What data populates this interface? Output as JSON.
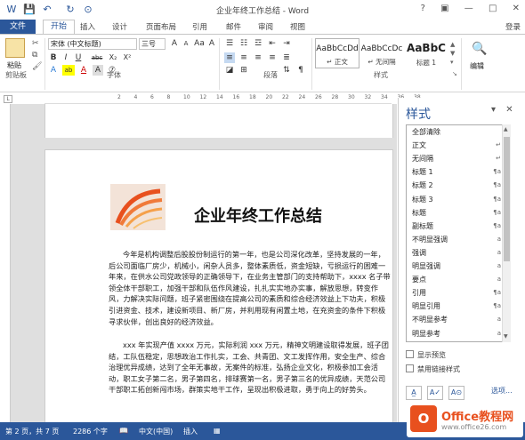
{
  "window": {
    "title": "企业年终工作总结 - Word",
    "help": "?",
    "signin": "登录"
  },
  "quick_access": {
    "save": "💾",
    "undo": "↶",
    "redo": "↻",
    "touch": "⊙"
  },
  "tabs": [
    "文件",
    "开始",
    "插入",
    "设计",
    "页面布局",
    "引用",
    "邮件",
    "审阅",
    "视图"
  ],
  "ribbon": {
    "clipboard": {
      "paste": "粘贴",
      "group": "剪贴板"
    },
    "font": {
      "name": "宋体 (中文标题)",
      "size": "三号",
      "group": "字体",
      "buttons_row1": [
        "A",
        "A",
        "Aa",
        "A",
        "wén"
      ],
      "buttons_row2": [
        "B",
        "I",
        "U",
        "abc",
        "X₂",
        "X²"
      ],
      "buttons_row3": [
        "A",
        "ab",
        "A",
        "A",
        "⑦"
      ]
    },
    "paragraph": {
      "group": "段落"
    },
    "styles": {
      "group": "样式",
      "items": [
        {
          "preview": "AaBbCcDd",
          "label": "↵ 正文"
        },
        {
          "preview": "AaBbCcDc",
          "label": "↵ 无间隔"
        },
        {
          "preview": "AaBbC",
          "label": "标题 1"
        }
      ]
    },
    "editing": {
      "label": "编辑"
    }
  },
  "ruler_ticks": [
    "2",
    "4",
    "6",
    "8",
    "10",
    "12",
    "14",
    "16",
    "18",
    "20",
    "22",
    "24",
    "26",
    "28",
    "30",
    "32",
    "34",
    "36",
    "38"
  ],
  "document": {
    "title": "企业年终工作总结",
    "paragraphs": [
      "今年是机构调整后股股份制运行的第一年，也是公司深化改革，坚持发展的一年，后公司面临厂房少，机械小，闲杂人员多，整体素质低，资金短缺，亏损运行的困难一年来，在供水公司党政领导的正确领导下，在业务主管部门的支持帮助下，xxxx 名子带领全体干部职工，加强干部和队伍作风建设，扎扎实实地办实事，解放思想，转变作风，力解决实际问题，班子紧密围绕在提高公司的素质和综合经济效益上下功夫，积极引进资金、技术，建设新项目、新厂房，并利用现有闲置土地，在充资金的条件下积极寻求伙伴，创出良好的经济效益。",
      "xxx 年实现产值 xxxx 万元，实际利润 xxx 万元，精神文明建设取得发展，班子团结，工队伍稳定，思想政治工作扎实，工会、共青团、文工发挥作用，安全生产、综合治理优异成绩，达到了全年无事故，无案件的标准，弘扬企业文化，积极参加工会活动，职工女子第二名，男子第四名，排球赛第一名，男子第三名的优异成绩，天范公司干部职工拓创新闯市场，群策实地干工作，呈现出积极进取，勇于向上的好势头。"
    ]
  },
  "styles_pane": {
    "title": "样式",
    "items": [
      {
        "name": "全部清除",
        "key": ""
      },
      {
        "name": "正文",
        "key": "↵"
      },
      {
        "name": "无间隔",
        "key": "↵"
      },
      {
        "name": "标题 1",
        "key": "¶a"
      },
      {
        "name": "标题 2",
        "key": "¶a"
      },
      {
        "name": "标题 3",
        "key": "¶a"
      },
      {
        "name": "标题",
        "key": "¶a"
      },
      {
        "name": "副标题",
        "key": "¶a"
      },
      {
        "name": "不明显强调",
        "key": "a"
      },
      {
        "name": "强调",
        "key": "a"
      },
      {
        "name": "明显强调",
        "key": "a"
      },
      {
        "name": "要点",
        "key": "a"
      },
      {
        "name": "引用",
        "key": "¶a"
      },
      {
        "name": "明显引用",
        "key": "¶a"
      },
      {
        "name": "不明显参考",
        "key": "a"
      },
      {
        "name": "明显参考",
        "key": "a"
      }
    ],
    "show_preview": "显示预览",
    "disable_linked": "禁用链接样式",
    "buttons": [
      "A̲",
      "A✓",
      "A⊙"
    ],
    "options": "选项..."
  },
  "status": {
    "page": "第 2 页，共 7 页",
    "words": "2286 个字",
    "proof": "📖",
    "lang": "中文(中国)",
    "mode": "插入"
  },
  "watermark": {
    "badge": "O",
    "name": "Office教程网",
    "url": "www.office26.com"
  },
  "colors": {
    "accent": "#2b579a",
    "watermark": "#e8501e"
  }
}
